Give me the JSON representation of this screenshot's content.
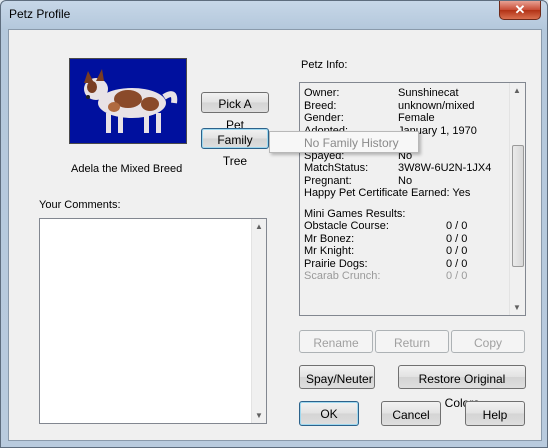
{
  "window": {
    "title": "Petz Profile",
    "close_glyph": "✕"
  },
  "pet": {
    "caption": "Adela the Mixed Breed"
  },
  "buttons": {
    "pick_a_pet": "Pick A Pet",
    "family_tree": "Family Tree",
    "rename": "Rename",
    "return": "Return",
    "copy": "Copy",
    "spay_neuter": "Spay/Neuter",
    "restore_colors": "Restore Original Colors",
    "ok": "OK",
    "cancel": "Cancel",
    "help": "Help"
  },
  "tooltip": {
    "text": "No Family History"
  },
  "comments": {
    "label": "Your Comments:",
    "value": ""
  },
  "info": {
    "label": "Petz Info:",
    "rows": [
      {
        "key": "Owner:",
        "value": "Sunshinecat"
      },
      {
        "key": "Breed:",
        "value": "unknown/mixed"
      },
      {
        "key": "Gender:",
        "value": "Female"
      },
      {
        "key": "Adopted:",
        "value": "January 1, 1970"
      },
      {
        "key": "",
        "value": ""
      },
      {
        "key": "Spayed:",
        "value": "No"
      },
      {
        "key": "MatchStatus:",
        "value": "3W8W-6U2N-1JX4"
      },
      {
        "key": "Pregnant:",
        "value": "No"
      }
    ],
    "certificate": "Happy Pet Certificate Earned: Yes",
    "games_title": "Mini Games Results:",
    "games": [
      {
        "name": "Obstacle Course:",
        "score": "0 / 0"
      },
      {
        "name": "Mr Bonez:",
        "score": "0 / 0"
      },
      {
        "name": "Mr Knight:",
        "score": "0 / 0"
      },
      {
        "name": "Prairie Dogs:",
        "score": "0 / 0"
      },
      {
        "name": "Scarab Crunch:",
        "score": "0 / 0"
      }
    ]
  },
  "icons": {
    "close": "close-icon",
    "scroll_up": "▲",
    "scroll_down": "▼"
  }
}
